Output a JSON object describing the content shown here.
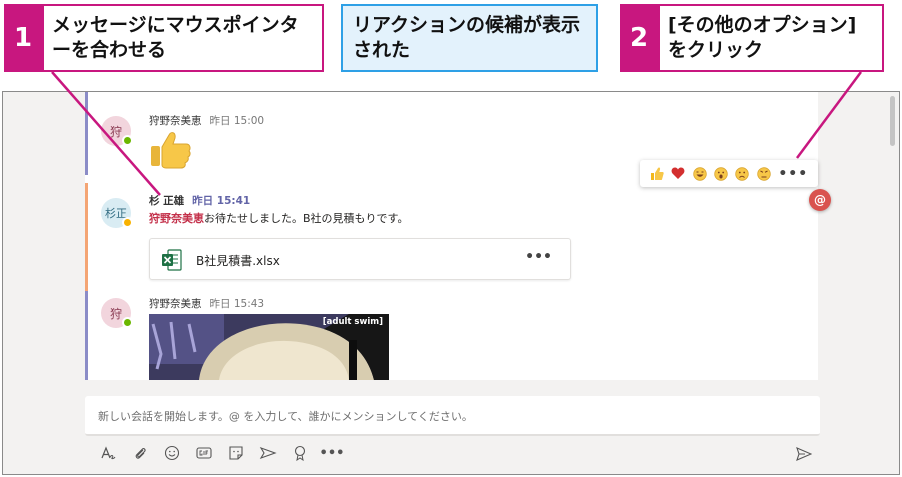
{
  "callouts": [
    {
      "number": "1",
      "text": "メッセージにマウスポインターを合わせる"
    },
    {
      "text": "リアクションの候補が表示された"
    },
    {
      "number": "2",
      "text": "[その他のオプション]をクリック"
    }
  ],
  "thread": {
    "messages": [
      {
        "avatar": "狩",
        "sender": "狩野奈美恵",
        "time": "昨日 15:00",
        "content": "thumbs-up-sticker"
      },
      {
        "avatar": "杉正",
        "sender": "杉 正雄",
        "time": "昨日 15:41",
        "mention": "狩野奈美恵",
        "text": "お待たせしました。B社の見積もりです。",
        "file": {
          "name": "B社見積書.xlsx",
          "more": "•••"
        }
      },
      {
        "avatar": "狩",
        "sender": "狩野奈美恵",
        "time": "昨日 15:43",
        "gif_label": "[adult swim]"
      }
    ],
    "reactions": [
      "like",
      "heart",
      "laugh",
      "surprised",
      "sad",
      "angry"
    ],
    "more_options": "•••",
    "mention_badge": "@"
  },
  "compose": {
    "placeholder": "新しい会話を開始します。@ を入力して、誰かにメンションしてください。",
    "toolbar_more": "•••"
  },
  "colors": {
    "callout_magenta": "#c8177f",
    "callout_blue": "#2ea0e6",
    "teams_purple": "#6264a7",
    "mention_red": "#c4314b",
    "presence_green": "#6bb700",
    "presence_away": "#f8b200"
  }
}
